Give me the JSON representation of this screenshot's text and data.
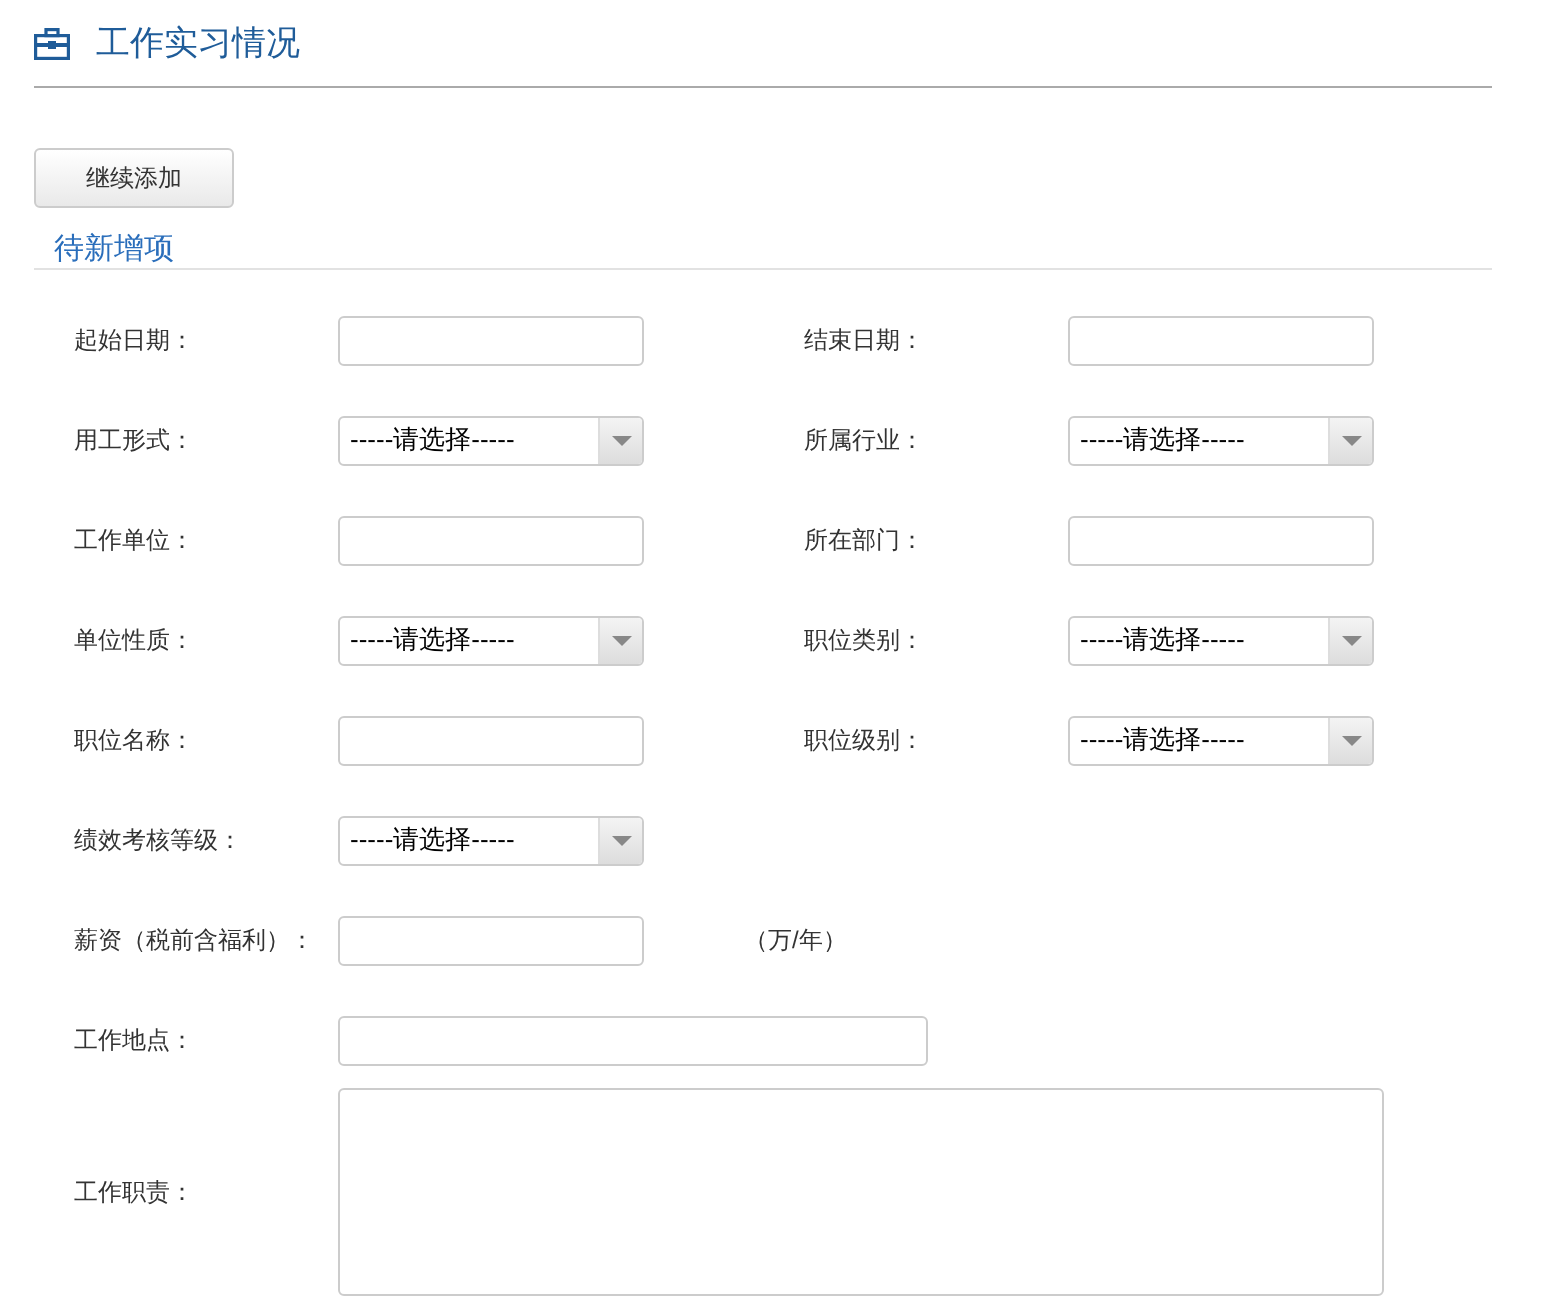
{
  "header": {
    "title": "工作实习情况"
  },
  "add_button": "继续添加",
  "section_title": "待新增项",
  "rows": [
    {
      "fields": [
        {
          "label": "起始日期：",
          "kind": "text"
        },
        {
          "label": "结束日期：",
          "kind": "text"
        }
      ]
    },
    {
      "fields": [
        {
          "label": "用工形式：",
          "kind": "select",
          "value": "-----请选择-----"
        },
        {
          "label": "所属行业：",
          "kind": "select",
          "value": "-----请选择-----"
        }
      ]
    },
    {
      "fields": [
        {
          "label": "工作单位：",
          "kind": "text"
        },
        {
          "label": "所在部门：",
          "kind": "text"
        }
      ]
    },
    {
      "fields": [
        {
          "label": "单位性质：",
          "kind": "select",
          "value": "-----请选择-----"
        },
        {
          "label": "职位类别：",
          "kind": "select",
          "value": "-----请选择-----"
        }
      ]
    },
    {
      "fields": [
        {
          "label": "职位名称：",
          "kind": "text"
        },
        {
          "label": "职位级别：",
          "kind": "select",
          "value": "-----请选择-----"
        }
      ]
    },
    {
      "fields": [
        {
          "label": "绩效考核等级：",
          "kind": "select",
          "value": "-----请选择-----"
        }
      ]
    },
    {
      "fields": [
        {
          "label": "薪资（税前含福利）：",
          "kind": "text",
          "suffix": "（万/年）"
        }
      ]
    },
    {
      "fields": [
        {
          "label": "工作地点：",
          "kind": "wide"
        }
      ]
    },
    {
      "fields": [
        {
          "label": "工作职责：",
          "kind": "textarea"
        }
      ]
    }
  ]
}
